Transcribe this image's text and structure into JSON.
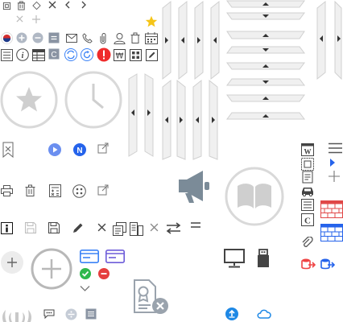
{
  "sprite_sheet": {
    "icons": [
      "copy-icon",
      "trash-icon",
      "diamond-icon",
      "close-icon",
      "chevron-left-icon",
      "chevron-right-icon",
      "close-light-icon",
      "plus-light-icon",
      "star-filled-icon",
      "flag-icon",
      "add-circle-icon",
      "remove-circle-icon",
      "minus-square-icon",
      "mail-icon",
      "phone-icon",
      "attach-icon",
      "user-icon",
      "delete-icon",
      "calendar-icon",
      "list-icon",
      "info-icon",
      "table-icon",
      "c-badge-icon",
      "sync-icon",
      "refresh-icon",
      "alert-icon",
      "currency-won-icon",
      "grid-icon",
      "edit-icon",
      "star-circle-large-icon",
      "clock-circle-large-icon",
      "collapse-panel-left-icons",
      "collapse-panel-right-icons",
      "collapse-panel-up-icons",
      "bookmark-x-icon",
      "play-circle-icon",
      "n-badge-icon",
      "external-link-icon",
      "print-icon",
      "trash-outline-icon",
      "calculator-icon",
      "options-circle-icon",
      "external-link-2-icon",
      "megaphone-icon",
      "book-circle-icon",
      "info-black-icon",
      "save-gray-icon",
      "save-icon",
      "pencil-icon",
      "close-dark-icon",
      "copy-doc-icon",
      "document-list-icon",
      "close-thin-icon",
      "swap-icon",
      "equals-icon",
      "add-small-circle-icon",
      "add-large-circle-icon",
      "card-blue-icon",
      "card-purple-icon",
      "check-green-icon",
      "remove-red-icon",
      "chevron-down-icon",
      "certificate-remove-icon",
      "monitor-icon",
      "usb-icon",
      "laurel-icon",
      "chat-icon",
      "divide-icon",
      "list-compact-icon",
      "upload-circle-icon",
      "cloud-icon",
      "w-doc-icon",
      "doc-stack-icon",
      "doc-outline-icon",
      "car-icon",
      "list-box-icon",
      "c-doc-icon",
      "attach-icon-2",
      "db-export-icon",
      "db-sync-icon",
      "hamburger-icon",
      "triangle-right-icon",
      "plus-thin-icon",
      "brick-red-icon",
      "brick-blue-icon"
    ],
    "badges": {
      "n_label": "N",
      "c_label": "C",
      "w_label": "W",
      "c_doc_label": "C",
      "won_label": "₩",
      "info_label": "i"
    },
    "colors": {
      "accent_blue": "#3b82f6",
      "accent_green": "#22c55e",
      "accent_red": "#ef4444",
      "star_yellow": "#f5c518",
      "gray_light": "#d9d9d9",
      "gray_dark": "#555555"
    }
  }
}
